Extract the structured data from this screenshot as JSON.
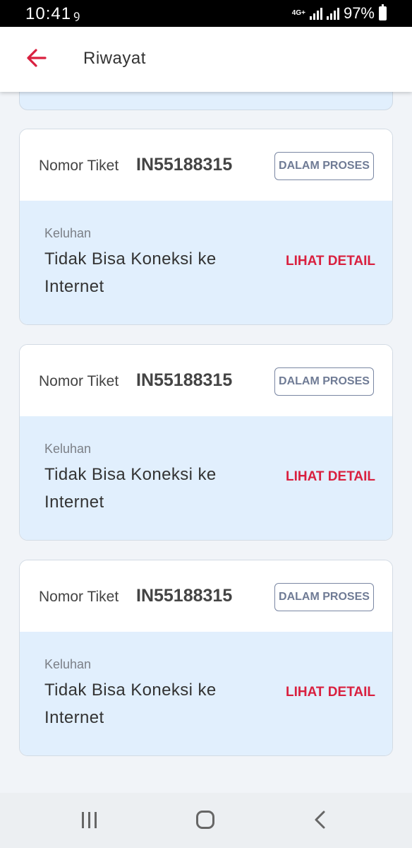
{
  "status_bar": {
    "time": "10:41",
    "notification_icon": "ꝯ",
    "network": "4G+",
    "battery": "97%"
  },
  "app_bar": {
    "title": "Riwayat",
    "accent_color": "#d9203f"
  },
  "tickets": [
    {
      "label": "Nomor Tiket",
      "number": "IN55188315",
      "status": "DALAM PROSES",
      "complaint_label": "Keluhan",
      "complaint": "Tidak Bisa Koneksi ke Internet",
      "detail_link": "LIHAT DETAIL"
    },
    {
      "label": "Nomor Tiket",
      "number": "IN55188315",
      "status": "DALAM PROSES",
      "complaint_label": "Keluhan",
      "complaint": "Tidak Bisa Koneksi ke Internet",
      "detail_link": "LIHAT DETAIL"
    },
    {
      "label": "Nomor Tiket",
      "number": "IN55188315",
      "status": "DALAM PROSES",
      "complaint_label": "Keluhan",
      "complaint": "Tidak Bisa Koneksi ke Internet",
      "detail_link": "LIHAT DETAIL"
    }
  ],
  "icons": {
    "back": "arrow-left-icon",
    "nav_recent": "recent-apps-icon",
    "nav_home": "home-icon",
    "nav_back": "chevron-left-icon"
  }
}
